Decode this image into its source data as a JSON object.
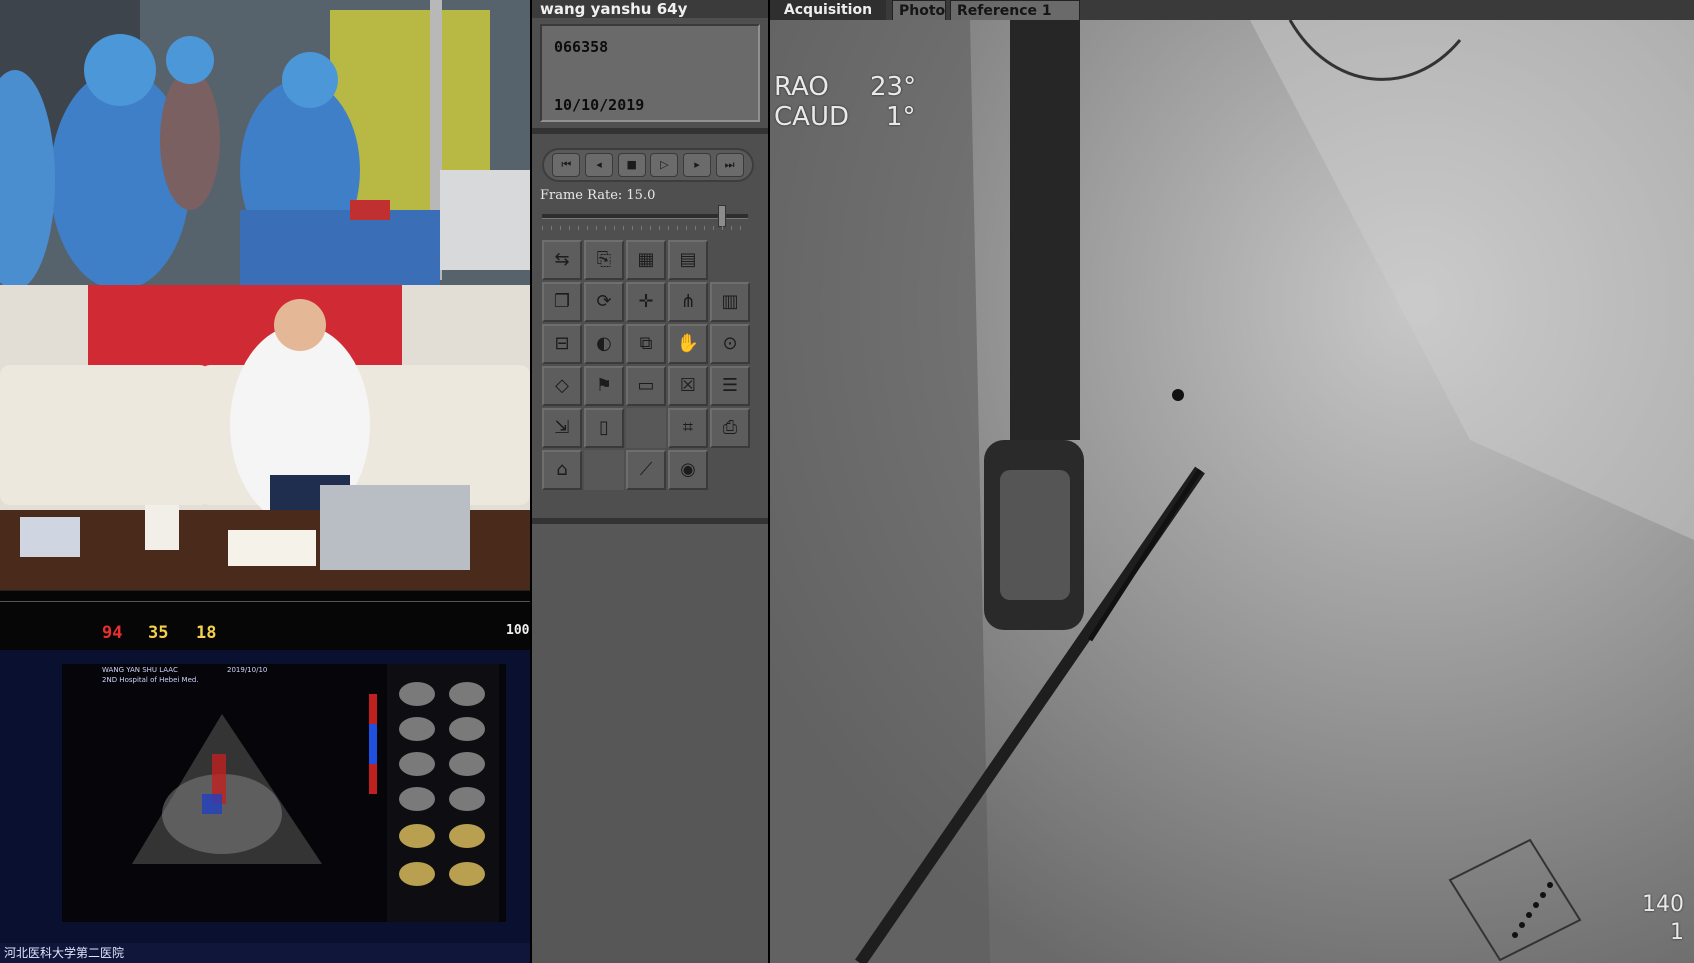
{
  "patient": {
    "name_age": "wang yanshu 64y",
    "id": "066358",
    "date": "10/10/2019"
  },
  "controls": {
    "frame_rate_label": "Frame Rate: 15.0"
  },
  "viewer": {
    "tabs": [
      "Acquisition",
      "Photo",
      "Reference 1"
    ],
    "rao_label": "RAO",
    "rao_value": "23°",
    "caud_label": "CAUD",
    "caud_value": "1°",
    "frame_number": "140",
    "frame_sub": "1"
  },
  "monitor": {
    "hr": "94",
    "bp1": "35",
    "bp2": "18",
    "spo2": "100"
  },
  "echo": {
    "patient_line": "WANG YAN SHU LAAC",
    "hospital_line": "2ND Hospital of Hebei Med.",
    "date_line": "2019/10/10"
  },
  "caption": {
    "hospital_name": "河北医科大学第二医院"
  },
  "colors": {
    "panel_bg": "#4f4f4f",
    "viewer_bg": "#777777",
    "hr_color": "#e83030",
    "bp_color": "#f2d24a"
  }
}
